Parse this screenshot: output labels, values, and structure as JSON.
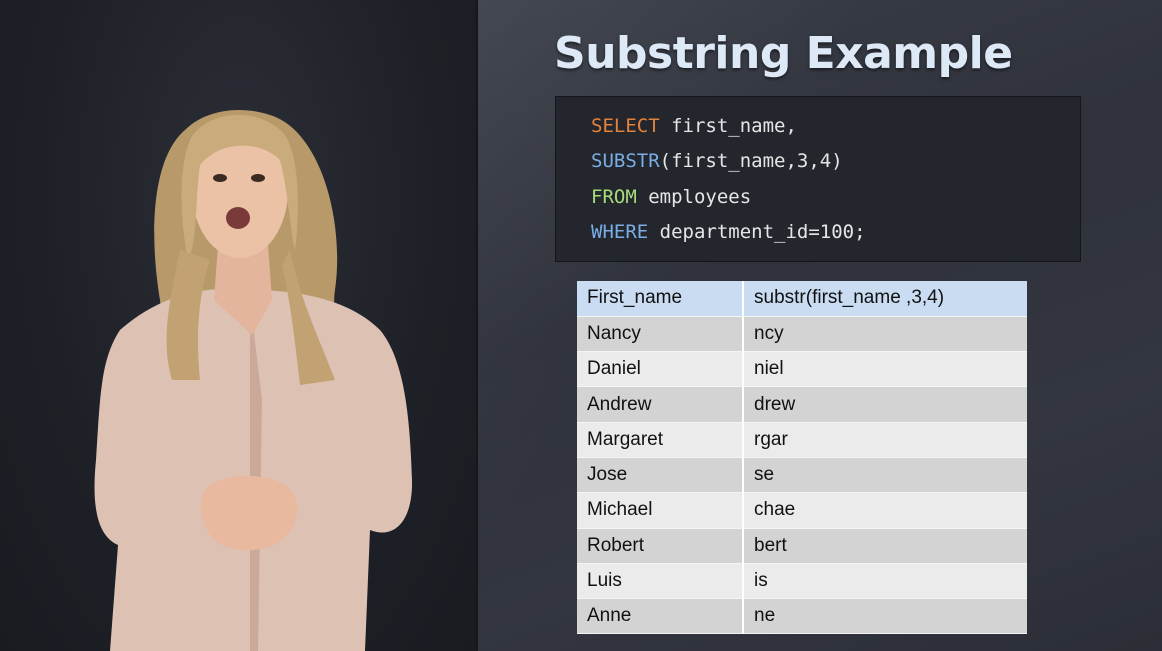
{
  "slide": {
    "title": "Substring Example"
  },
  "code": {
    "lines": [
      {
        "keyword": "SELECT",
        "rest": " first_name,"
      },
      {
        "keyword": "SUBSTR",
        "rest": "(first_name,3,4)"
      },
      {
        "keyword": "FROM",
        "rest": " employees"
      },
      {
        "keyword": "WHERE",
        "rest": " department_id=100;"
      }
    ],
    "colors": {
      "select": "#e5823a",
      "substr": "#7aaee4",
      "from": "#a7dc7c",
      "where": "#7aaee4"
    }
  },
  "table": {
    "headers": [
      "First_name",
      "substr(first_name ,3,4)"
    ],
    "rows": [
      [
        "Nancy",
        "ncy"
      ],
      [
        "Daniel",
        "niel"
      ],
      [
        "Andrew",
        "drew"
      ],
      [
        "Margaret",
        "rgar"
      ],
      [
        "Jose",
        "se"
      ],
      [
        "Michael",
        "chae"
      ],
      [
        "Robert",
        "bert"
      ],
      [
        "Luis",
        "is"
      ],
      [
        "Anne",
        "ne"
      ]
    ]
  },
  "colors": {
    "title": "#dde9f7",
    "header_bg": "#c9dcf2",
    "row_dark": "#d3d3d3",
    "row_light": "#ebebeb",
    "code_bg": "#23262d"
  }
}
